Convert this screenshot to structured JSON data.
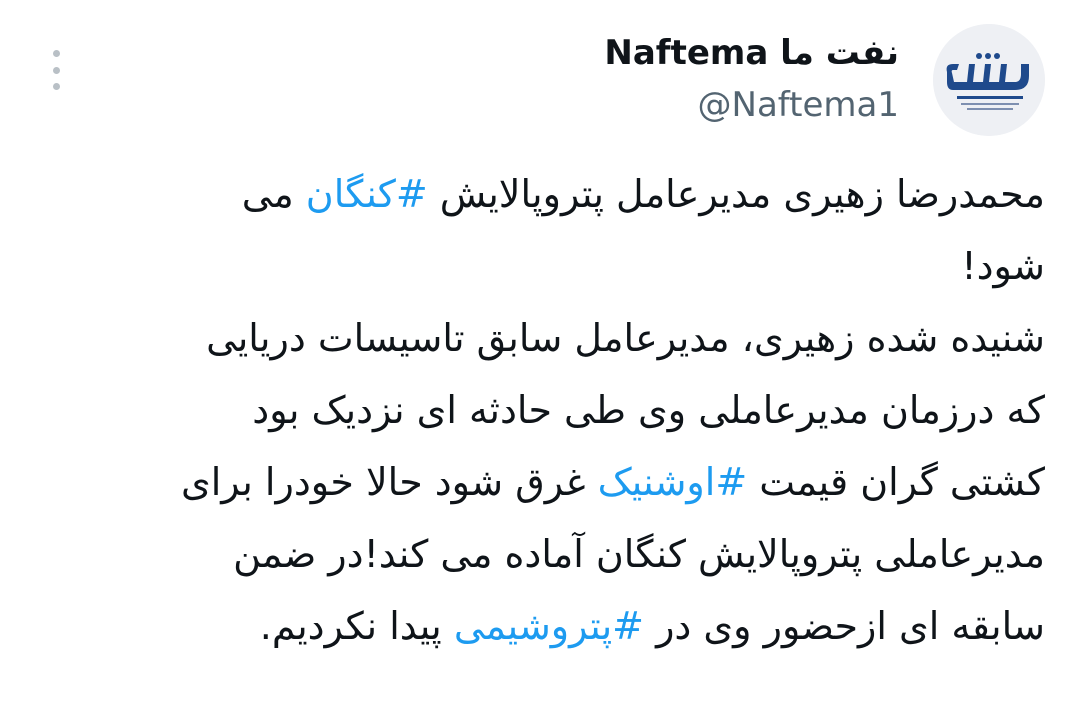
{
  "tweet": {
    "display_name": "نفت ما Naftema",
    "handle": "@Naftema1",
    "avatar_alt": "نفت ما",
    "body": {
      "line1": {
        "pre": "محمدرضا زهیری مدیرعامل پتروپالایش ",
        "tag": "#کنگان",
        "post": " می"
      },
      "line2": "شود!",
      "line3": "شنیده شده زهیری، مدیرعامل سابق تاسیسات دریایی",
      "line4": "که درزمان مدیرعاملی وی طی حادثه ای نزدیک بود",
      "line5": {
        "pre": "کشتی گران قیمت ",
        "tag": "#اوشنیک",
        "post": " غرق شود حالا خودرا برای"
      },
      "line6": "مدیرعاملی پتروپالایش کنگان آماده می کند!در ضمن",
      "line7": {
        "pre": "سابقه ای ازحضور وی در ",
        "tag": "#پتروشیمی",
        "post": " پیدا نکردیم."
      }
    }
  },
  "colors": {
    "text": "#0f1419",
    "secondary": "#536471",
    "link": "#1d9bf0",
    "icon": "#b9c0c6"
  },
  "icons": {
    "more": "more-vertical-icon"
  }
}
